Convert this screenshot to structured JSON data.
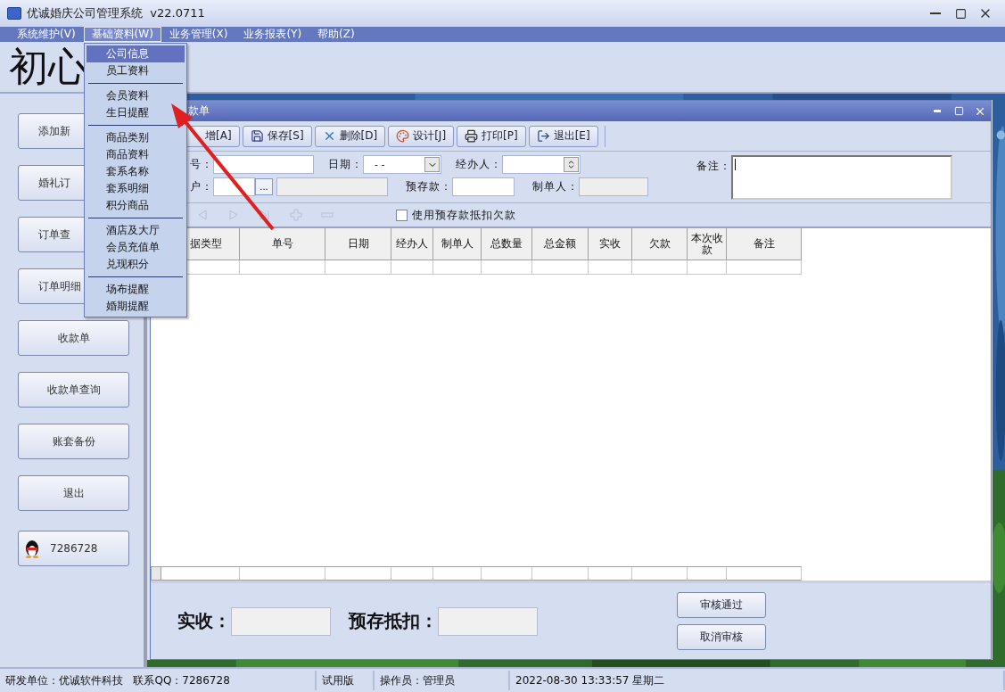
{
  "window": {
    "title": "优诚婚庆公司管理系统  v22.0711"
  },
  "menu_bar": [
    {
      "label": "系统维护(V)",
      "selected": false
    },
    {
      "label": "基础资料(W)",
      "selected": true
    },
    {
      "label": "业务管理(X)",
      "selected": false
    },
    {
      "label": "业务报表(Y)",
      "selected": false
    },
    {
      "label": "帮助(Z)",
      "selected": false
    }
  ],
  "open_menu": {
    "groups": [
      {
        "items": [
          {
            "label": "公司信息",
            "selected": true
          },
          {
            "label": "员工资料",
            "selected": false
          }
        ]
      },
      {
        "items": [
          {
            "label": "会员资料",
            "selected": false
          },
          {
            "label": "生日提醒",
            "selected": false
          }
        ]
      },
      {
        "items": [
          {
            "label": "商品类别",
            "selected": false
          },
          {
            "label": "商品资料",
            "selected": false
          },
          {
            "label": "套系名称",
            "selected": false
          },
          {
            "label": "套系明细",
            "selected": false
          },
          {
            "label": "积分商品",
            "selected": false
          }
        ]
      },
      {
        "items": [
          {
            "label": "酒店及大厅",
            "selected": false
          },
          {
            "label": "会员充值单",
            "selected": false
          },
          {
            "label": "兑现积分",
            "selected": false
          }
        ]
      },
      {
        "items": [
          {
            "label": "场布提醒",
            "selected": false
          },
          {
            "label": "婚期提醒",
            "selected": false
          }
        ]
      }
    ]
  },
  "header": {
    "logo_text": "初心"
  },
  "side_buttons": [
    {
      "label": "添加新",
      "kind": "text"
    },
    {
      "label": "婚礼订",
      "kind": "text"
    },
    {
      "label": "订单查",
      "kind": "text"
    },
    {
      "label": "订单明细",
      "kind": "text"
    },
    {
      "label": "收款单",
      "kind": "text"
    },
    {
      "label": "收款单查询",
      "kind": "text"
    },
    {
      "label": "账套备份",
      "kind": "text"
    },
    {
      "label": "退出",
      "kind": "text"
    },
    {
      "label": "7286728",
      "kind": "qq"
    }
  ],
  "child_window": {
    "title": "款单",
    "toolbar": [
      "增[A]",
      "保存[S]",
      "删除[D]",
      "设计[J]",
      "打印[P]",
      "退出[E]"
    ],
    "form_rows": [
      [
        {
          "label": "号：",
          "kind": "input"
        },
        {
          "label": "日期：",
          "kind": "date",
          "value": "- -"
        },
        {
          "label": "经办人：",
          "kind": "spin"
        }
      ],
      [
        {
          "label": "户：",
          "kind": "browse",
          "button": "..."
        },
        {
          "label": "预存款：",
          "kind": "input"
        },
        {
          "label": "制单人：",
          "kind": "readonly"
        }
      ]
    ],
    "remark": {
      "label": "备注："
    },
    "use_deposit": {
      "label": "使用预存款抵扣欠款",
      "checked": false
    },
    "grid": {
      "columns": [
        "据类型",
        "单号",
        "日期",
        "经办人",
        "制单人",
        "总数量",
        "总金额",
        "实收",
        "欠款",
        "本次收款",
        "备注"
      ]
    },
    "summary": [
      {
        "label": "实收："
      },
      {
        "label": "预存抵扣："
      }
    ],
    "buttons": [
      "审核通过",
      "取消审核"
    ]
  },
  "status_bar": [
    "研发单位：优诚软件科技   联系QQ：7286728",
    "试用版",
    "操作员：管理员",
    "2022-08-30 13:33:57 星期二"
  ]
}
